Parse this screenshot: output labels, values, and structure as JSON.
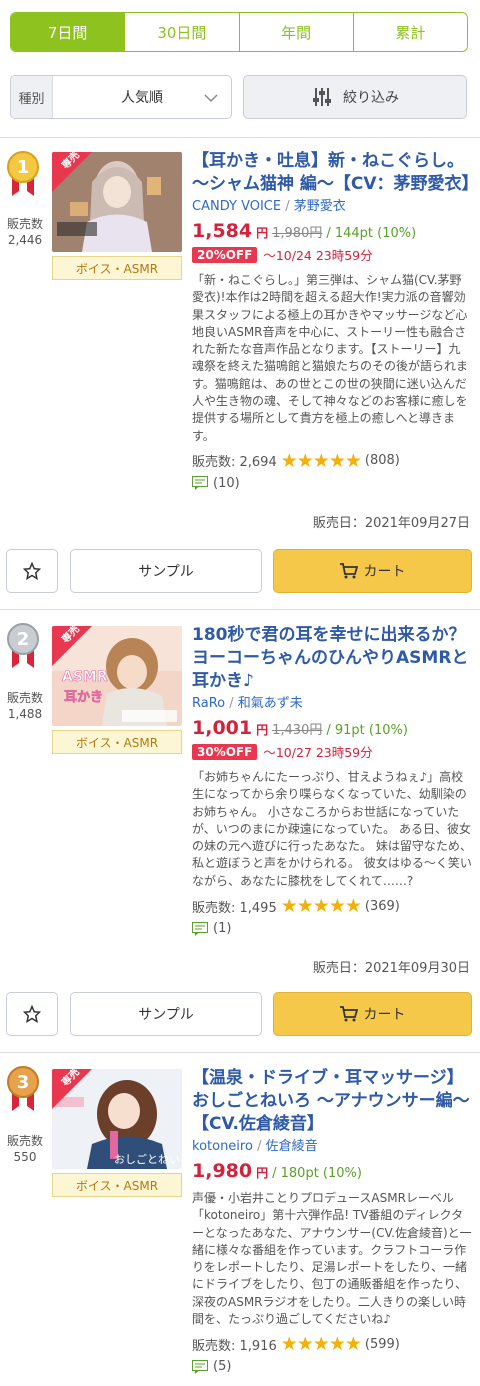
{
  "tabs": [
    {
      "label": "7日間",
      "active": true
    },
    {
      "label": "30日間",
      "active": false
    },
    {
      "label": "年間",
      "active": false
    },
    {
      "label": "累計",
      "active": false
    }
  ],
  "sort": {
    "label": "種別",
    "value": "人気順"
  },
  "filter": {
    "label": "絞り込み"
  },
  "buttons": {
    "sample": "サンプル",
    "cart": "カート"
  },
  "items": [
    {
      "rank": "1",
      "sales_label": "販売数",
      "sales_count": "2,446",
      "badge": "専売",
      "genre": "ボイス・ASMR",
      "title": "【耳かき・吐息】新・ねこぐらし。～シャム猫神 編～【CV：茅野愛衣】",
      "circle": "CANDY VOICE",
      "author": "茅野愛衣",
      "price": "1,584",
      "yen": "円",
      "original_price": "1,980円",
      "points": "144pt (10%)",
      "discount": "20%OFF",
      "sale_until": "～10/24 23時59分",
      "description": "「新・ねこぐらし。」第三弾は、シャム猫(CV.茅野愛衣)!本作は2時間を超える超大作!実力派の音響効果スタッフによる極上の耳かきやマッサージなど心地良いASMR音声を中心に、ストーリー性も融合された新たな音声作品となります。【ストーリー】九魂祭を終えた猫鳴館と猫娘たちのその後が語られます。猫鳴館は、あの世とこの世の狭間に迷い込んだ人や生き物の魂、そして神々などのお客様に癒しを提供する場所として貴方を極上の癒しへと導きます。",
      "stats_label": "販売数: 2,694",
      "rating": 5,
      "rating_count": "(808)",
      "review_count": "(10)",
      "release_date": "販売日：2021年09月27日"
    },
    {
      "rank": "2",
      "sales_label": "販売数",
      "sales_count": "1,488",
      "badge": "専売",
      "genre": "ボイス・ASMR",
      "title": "180秒で君の耳を幸せに出来るか？ヨーコーちゃんのひんやりASMRと耳かき♪",
      "circle": "RaRo",
      "author": "和氣あず未",
      "price": "1,001",
      "yen": "円",
      "original_price": "1,430円",
      "points": "91pt (10%)",
      "discount": "30%OFF",
      "sale_until": "～10/27 23時59分",
      "description": "「お姉ちゃんにたーっぷり、甘えようねぇ♪」高校生になってから余り喋らなくなっていた、幼馴染のお姉ちゃん。 小さなころからお世話になっていたが、いつのまにか疎遠になっていた。 ある日、彼女の妹の元へ遊びに行ったあなた。 妹は留守なため、私と遊ぼうと声をかけられる。 彼女はゆる～く笑いながら、あなたに膝枕をしてくれて……?",
      "stats_label": "販売数: 1,495",
      "rating": 5,
      "rating_count": "(369)",
      "review_count": "(1)",
      "release_date": "販売日：2021年09月30日"
    },
    {
      "rank": "3",
      "sales_label": "販売数",
      "sales_count": "550",
      "badge": "専売",
      "genre": "ボイス・ASMR",
      "title": "【温泉・ドライブ・耳マッサージ】おしごとねいろ ～アナウンサー編～【CV.佐倉綾音】",
      "circle": "kotoneiro",
      "author": "佐倉綾音",
      "price": "1,980",
      "yen": "円",
      "points": "180pt (10%)",
      "description": "声優・小岩井ことりプロデュースASMRレーベル「kotoneiro」第十六弾作品! TV番組のディレクターとなったあなた、アナウンサー(CV.佐倉綾音)と一緒に様々な番組を作っています。クラフトコーラ作りをレポートしたり、足湯レポートをしたり、一緒にドライブをしたり、包丁の通販番組を作ったり、深夜のASMRラジオをしたり。二人きりの楽しい時間を、たっぷり過ごしてくださいね♪",
      "stats_label": "販売数: 1,916",
      "rating": 5,
      "rating_count": "(599)",
      "review_count": "(5)"
    }
  ],
  "colors": {
    "accent_green": "#8dc21f",
    "title_blue": "#2e5aa8",
    "price_red": "#d3233c",
    "star_gold": "#f2b10a",
    "cart_yellow": "#f5c84a"
  },
  "icons": [
    "chevron-down-icon",
    "filter-sliders-icon",
    "star-outline-icon",
    "cart-icon",
    "comment-icon",
    "rank-medal-icon"
  ]
}
